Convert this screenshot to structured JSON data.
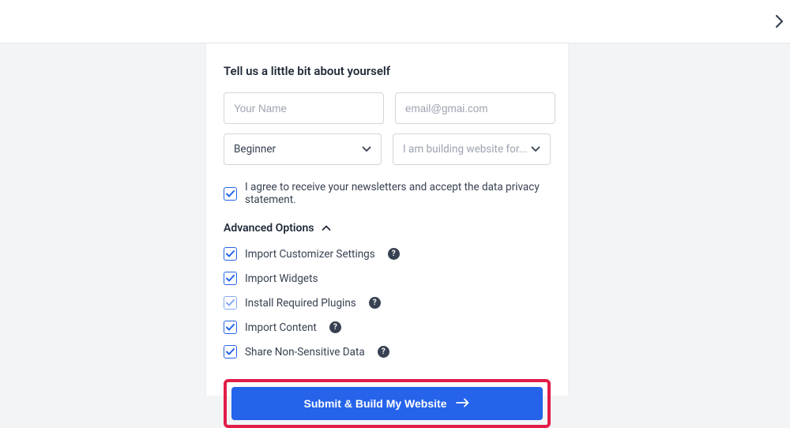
{
  "heading": "Tell us a little bit about yourself",
  "name_placeholder": "Your Name",
  "email_placeholder": "email@gmai.com",
  "level_value": "Beginner",
  "purpose_placeholder": "I am building website for...",
  "consent_label": "I agree to receive your newsletters and accept the data privacy statement.",
  "advanced_label": "Advanced Options",
  "advanced": {
    "import_customizer": "Import Customizer Settings",
    "import_widgets": "Import Widgets",
    "install_plugins": "Install Required Plugins",
    "import_content": "Import Content",
    "share_data": "Share Non-Sensitive Data"
  },
  "submit_label": "Submit & Build My Website"
}
